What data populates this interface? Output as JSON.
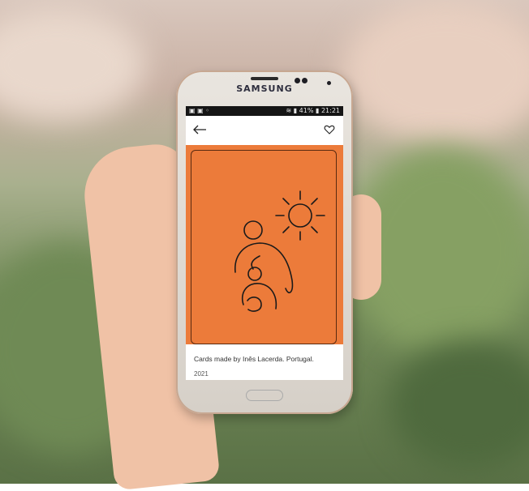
{
  "device": {
    "brand": "SAMSUNG"
  },
  "status_bar": {
    "right_text": "41%  21:21",
    "battery": "41%",
    "time": "21:21"
  },
  "app_bar": {
    "back_icon": "arrow-left-icon",
    "favorite_icon": "heart-outline-icon"
  },
  "card": {
    "background_color": "#ec7b3a",
    "art_description_icon": "sun-figures-illustration"
  },
  "caption": {
    "text": "Cards made by Inês Lacerda. Portugal.",
    "year": "2021"
  }
}
